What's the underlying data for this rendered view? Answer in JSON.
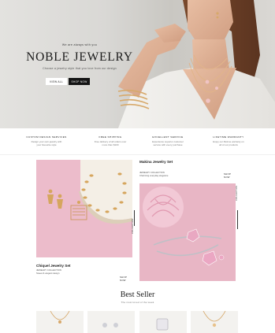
{
  "hero": {
    "eyebrow": "We are always with you",
    "title": "NOBLE JEWELRY",
    "subtitle": "Choose a jewelry style that you love from our design",
    "btn_view": "VIEW ALL",
    "btn_shop": "SHOP NOW"
  },
  "features": [
    {
      "title": "CUSTOM DESIGN SERVICES",
      "desc_1": "Design your own jewelry with",
      "desc_2": "your favourite style"
    },
    {
      "title": "FREE SHIPPING",
      "desc_1": "Free delivery of all orders over",
      "desc_2": "more than $100"
    },
    {
      "title": "EXCELLENT SERVICE",
      "desc_1": "Experience superior customer",
      "desc_2": "service with every purchase"
    },
    {
      "title": "LIFETIME WARRANTY",
      "desc_1": "Enjoy our lifetime warranty on",
      "desc_2": "all of our products"
    }
  ],
  "collections": {
    "left": {
      "title": "Chiquel Jewelry Set",
      "meta_1": "JEWELRY COLLECTION",
      "meta_2": "Sweet & elegant design",
      "shop": "SHOP NOW",
      "tag": "COLLECTION"
    },
    "right": {
      "title": "Makina Jewelry Set",
      "meta_1": "JEWELRY COLLECTION",
      "meta_2": "Charming everyday elegance",
      "shop": "SHOP NOW",
      "tag": "COLLECTION"
    }
  },
  "bestseller": {
    "title": "Best Seller",
    "subtitle": "The most loved of the week"
  },
  "colors": {
    "pink_bg": "#ecbccb",
    "accent_dark": "#141414",
    "gold": "#d7a96b"
  },
  "icons": [
    "necklace-image",
    "earring-image",
    "bracelet-image",
    "ring-image"
  ]
}
